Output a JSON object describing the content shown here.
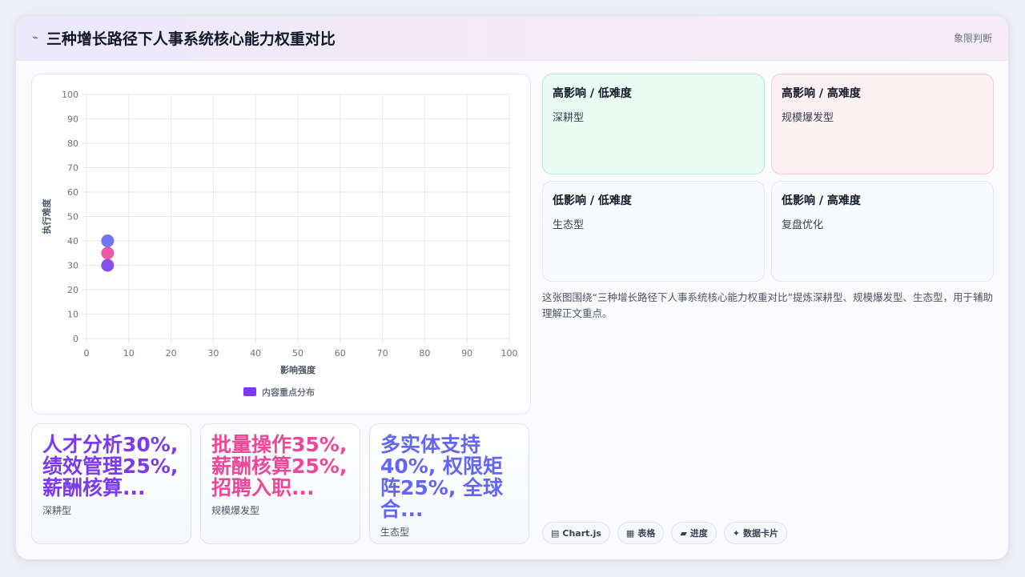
{
  "header": {
    "icon": "lightning-icon",
    "title": "三种增长路径下人事系统核心能力权重对比",
    "tag": "象限判断"
  },
  "chart_data": {
    "type": "scatter",
    "xlabel": "影响强度",
    "ylabel": "执行难度",
    "xlim": [
      0,
      100
    ],
    "ylim": [
      0,
      100
    ],
    "xticks": [
      "0",
      "10",
      "20",
      "30",
      "40",
      "50",
      "60",
      "70",
      "80",
      "90",
      "100"
    ],
    "yticks": [
      "0",
      "10",
      "20",
      "30",
      "40",
      "50",
      "60",
      "70",
      "80",
      "90",
      "100"
    ],
    "grid": true,
    "legend": {
      "position": "bottom",
      "label": "内容重点分布",
      "color": "#7c3aed"
    },
    "points": [
      {
        "x": 5,
        "y": 30,
        "color": "#7c3aed"
      },
      {
        "x": 5,
        "y": 35,
        "color": "#ec4899"
      },
      {
        "x": 5,
        "y": 40,
        "color": "#6366f1"
      }
    ]
  },
  "quadrants": [
    {
      "title": "高影响 / 低难度",
      "label": "深耕型"
    },
    {
      "title": "高影响 / 高难度",
      "label": "规模爆发型"
    },
    {
      "title": "低影响 / 低难度",
      "label": "生态型"
    },
    {
      "title": "低影响 / 高难度",
      "label": "复盘优化"
    }
  ],
  "description": "这张图围绕“三种增长路径下人事系统核心能力权重对比”提炼深耕型、规模爆发型、生态型，用于辅助理解正文重点。",
  "chips": [
    {
      "icon": "chart-icon",
      "glyph": "▤",
      "label": "Chart.js"
    },
    {
      "icon": "table-icon",
      "glyph": "▦",
      "label": "表格"
    },
    {
      "icon": "progress-icon",
      "glyph": "▰",
      "label": "进度"
    },
    {
      "icon": "sparkle-icon",
      "glyph": "✦",
      "label": "数据卡片"
    }
  ],
  "stats": [
    {
      "value": "人才分析30%, 绩效管理25%, 薪酬核算...",
      "label": "深耕型",
      "color": "#7c3aed"
    },
    {
      "value": "批量操作35%, 薪酬核算25%, 招聘入职...",
      "label": "规模爆发型",
      "color": "#ec4899"
    },
    {
      "value": "多实体支持40%, 权限矩阵25%, 全球合...",
      "label": "生态型",
      "color": "#6366f1"
    }
  ]
}
